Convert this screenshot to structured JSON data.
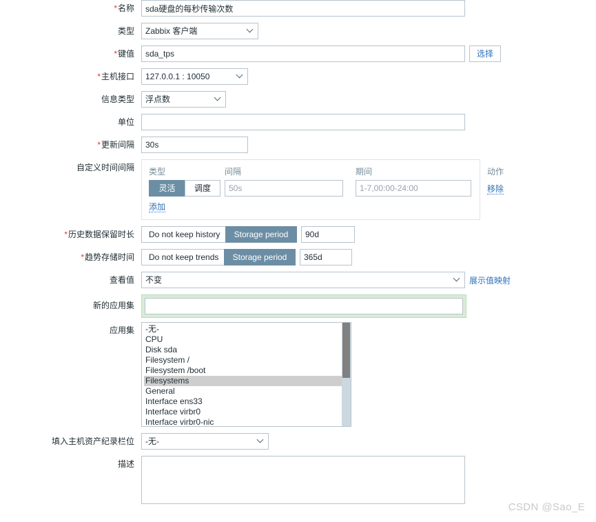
{
  "colors": {
    "accent_toggle_on": "#6c8ea4",
    "link": "#2e70b8",
    "required_asterisk": "#e33734",
    "highlight_green": "#d7ecd7",
    "scrollbar_thumb": "#808080",
    "scrollbar_track": "#ccd8e0",
    "selected_option": "#cecece"
  },
  "form": {
    "name": {
      "label": "名称",
      "required": true,
      "value": "sda硬盘的每秒传输次数"
    },
    "type": {
      "label": "类型",
      "required": false,
      "value": "Zabbix 客户端",
      "options": [
        "Zabbix 客户端"
      ]
    },
    "key": {
      "label": "键值",
      "required": true,
      "value": "sda_tps",
      "select_button": "选择"
    },
    "host_interface": {
      "label": "主机接口",
      "required": true,
      "value": "127.0.0.1 : 10050",
      "options": [
        "127.0.0.1 : 10050"
      ]
    },
    "info_type": {
      "label": "信息类型",
      "required": false,
      "value": "浮点数",
      "options": [
        "浮点数"
      ]
    },
    "units": {
      "label": "单位",
      "required": false,
      "value": ""
    },
    "update_interval": {
      "label": "更新间隔",
      "required": true,
      "value": "30s"
    },
    "custom_intervals": {
      "label": "自定义时间间隔",
      "headers": {
        "type": "类型",
        "interval": "间隔",
        "period": "期间",
        "action": "动作"
      },
      "rows": [
        {
          "type_options": [
            "灵活",
            "调度"
          ],
          "type_selected": "灵活",
          "interval_placeholder": "50s",
          "interval_value": "",
          "period_placeholder": "1-7,00:00-24:00",
          "period_value": "",
          "remove_label": "移除"
        }
      ],
      "add_label": "添加"
    },
    "history": {
      "label": "历史数据保留时长",
      "required": true,
      "options": [
        "Do not keep history",
        "Storage period"
      ],
      "selected": "Storage period",
      "value": "90d"
    },
    "trends": {
      "label": "趋势存储时间",
      "required": true,
      "options": [
        "Do not keep trends",
        "Storage period"
      ],
      "selected": "Storage period",
      "value": "365d"
    },
    "value_map": {
      "label": "查看值",
      "required": false,
      "value": "不变",
      "options": [
        "不变"
      ],
      "link_label": "展示值映射"
    },
    "new_application": {
      "label": "新的应用集",
      "required": false,
      "value": "",
      "highlighted": true
    },
    "applications": {
      "label": "应用集",
      "required": false,
      "options": [
        "-无-",
        "CPU",
        "Disk sda",
        "Filesystem /",
        "Filesystem /boot",
        "Filesystems",
        "General",
        "Interface ens33",
        "Interface virbr0",
        "Interface virbr0-nic"
      ],
      "selected": "Filesystems"
    },
    "inventory_field": {
      "label": "填入主机资产纪录栏位",
      "required": false,
      "value": "-无-",
      "options": [
        "-无-"
      ]
    },
    "description": {
      "label": "描述",
      "required": false,
      "value": ""
    }
  },
  "watermark": {
    "text": "CSDN @Sao_E"
  }
}
